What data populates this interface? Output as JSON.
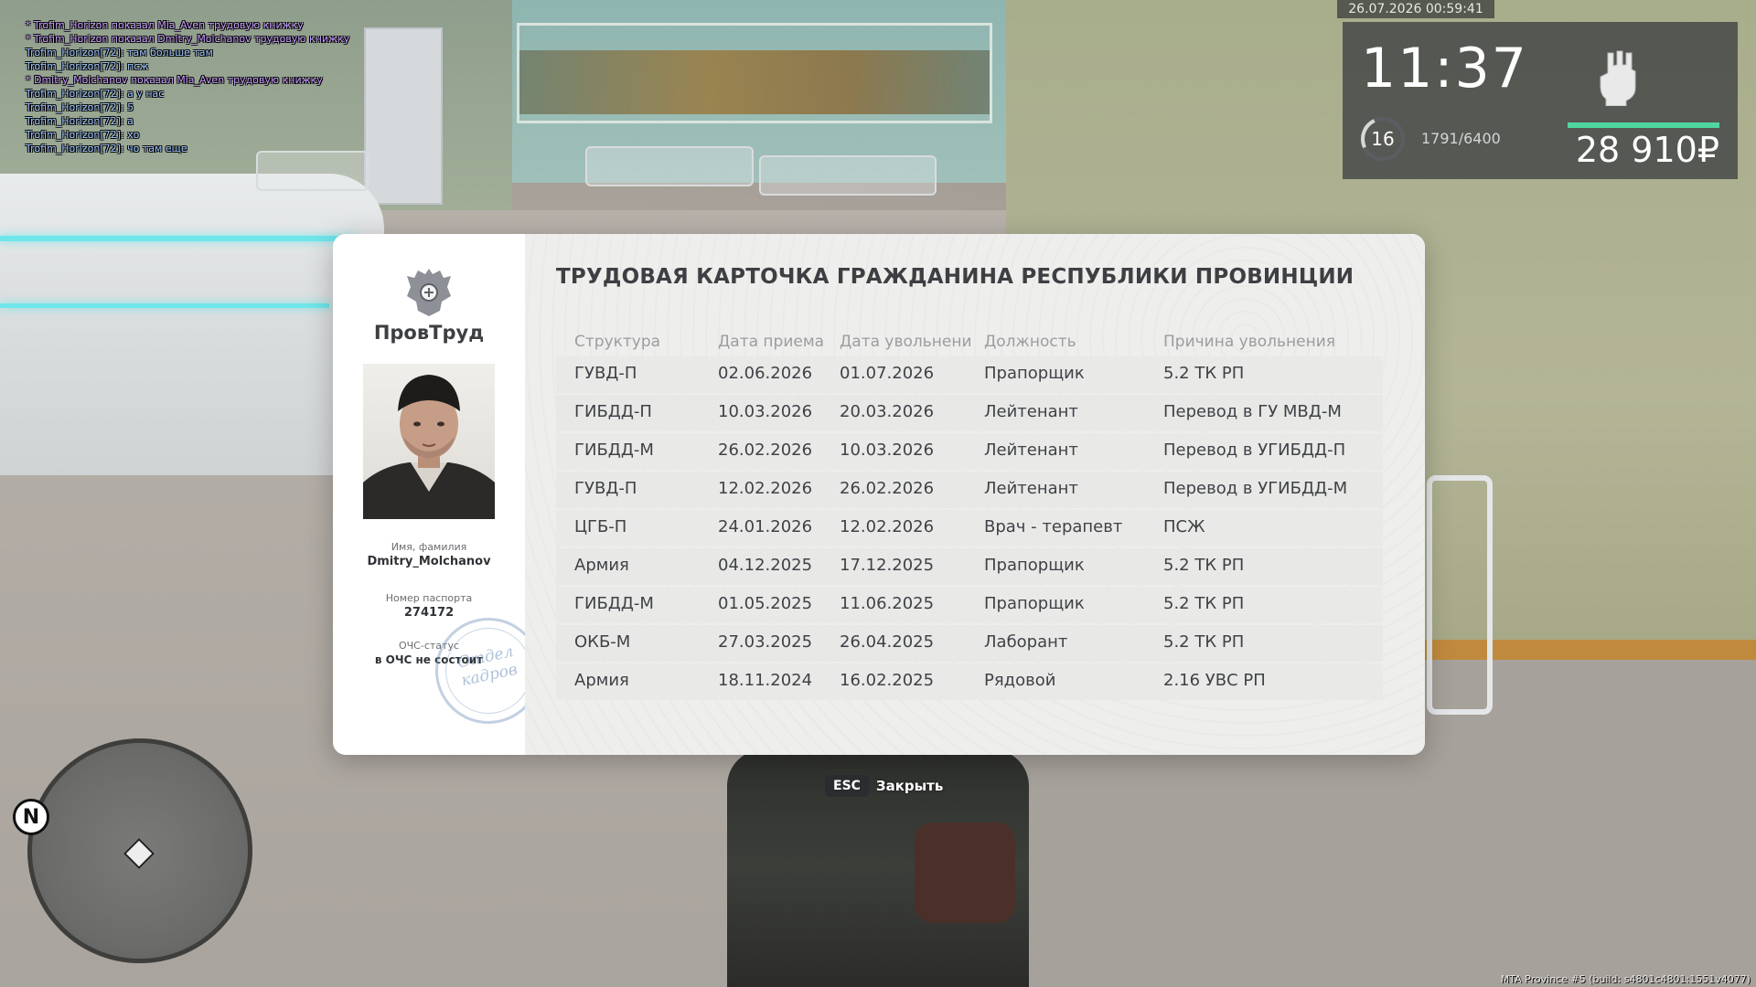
{
  "chat": [
    {
      "text": "* Trofim_Horizon показал Mia_Aven трудовую книжку",
      "color": "purple"
    },
    {
      "text": "* Trofim_Horizon показал Dmitry_Molchanov трудовую книжку",
      "color": "purple"
    },
    {
      "text": "Trofim_Horizon[72]: там больше там",
      "color": "blue"
    },
    {
      "text": "Trofim_Horizon[72]: псж",
      "color": "blue"
    },
    {
      "text": "* Dmitry_Molchanov показал Mia_Aven трудовую книжку",
      "color": "purple"
    },
    {
      "text": "Trofim_Horizon[72]: а у нас",
      "color": "blue"
    },
    {
      "text": "Trofim_Horizon[72]: 5",
      "color": "blue"
    },
    {
      "text": "Trofim_Horizon[72]: а",
      "color": "blue"
    },
    {
      "text": "Trofim_Horizon[72]: хо",
      "color": "blue"
    },
    {
      "text": "Trofim_Horizon[72]: чо там еще",
      "color": "blue"
    }
  ],
  "hud": {
    "datetime": "26.07.2026 00:59:41",
    "time": "11:37",
    "level": "16",
    "xp": "1791/6400",
    "xp_fraction": 0.28,
    "health_fraction": 1.0,
    "money": "28 910₽",
    "weapon_icon": "fist-icon"
  },
  "card": {
    "org_name": "ПровТруд",
    "title": "ТРУДОВАЯ КАРТОЧКА ГРАЖДАНИНА РЕСПУБЛИКИ ПРОВИНЦИИ",
    "name_label": "Имя, фамилия",
    "name_value": "Dmitry_Molchanov",
    "passport_label": "Номер паспорта",
    "passport_value": "274172",
    "ochs_label": "ОЧС-статус",
    "ochs_value": "в ОЧС не состоит",
    "stamp_text": "Отдел кадров",
    "columns": [
      "Структура",
      "Дата приема",
      "Дата увольнени",
      "Должность",
      "Причина увольнения"
    ],
    "rows": [
      [
        "ГУВД-П",
        "02.06.2026",
        "01.07.2026",
        "Прапорщик",
        "5.2 ТК РП"
      ],
      [
        "ГИБДД-П",
        "10.03.2026",
        "20.03.2026",
        "Лейтенант",
        "Перевод в ГУ МВД-М"
      ],
      [
        "ГИБДД-М",
        "26.02.2026",
        "10.03.2026",
        "Лейтенант",
        "Перевод в УГИБДД-П"
      ],
      [
        "ГУВД-П",
        "12.02.2026",
        "26.02.2026",
        "Лейтенант",
        "Перевод в УГИБДД-М"
      ],
      [
        "ЦГБ-П",
        "24.01.2026",
        "12.02.2026",
        "Врач - терапевт",
        "ПСЖ"
      ],
      [
        "Армия",
        "04.12.2025",
        "17.12.2025",
        "Прапорщик",
        "5.2 ТК РП"
      ],
      [
        "ГИБДД-М",
        "01.05.2025",
        "11.06.2025",
        "Прапорщик",
        "5.2 ТК РП"
      ],
      [
        "ОКБ-М",
        "27.03.2025",
        "26.04.2025",
        "Лаборант",
        "5.2 ТК РП"
      ],
      [
        "Армия",
        "18.11.2024",
        "16.02.2025",
        "Рядовой",
        "2.16 УВС РП"
      ]
    ]
  },
  "close": {
    "key": "ESC",
    "label": "Закрыть"
  },
  "minimap": {
    "north": "N"
  },
  "build_info": "MTA Province #5 (build: s4801c4801:1551v4077)",
  "colors": {
    "accent_health": "#4fd6a0",
    "chat_purple": "#c89cff",
    "chat_blue": "#9ec4ff"
  }
}
